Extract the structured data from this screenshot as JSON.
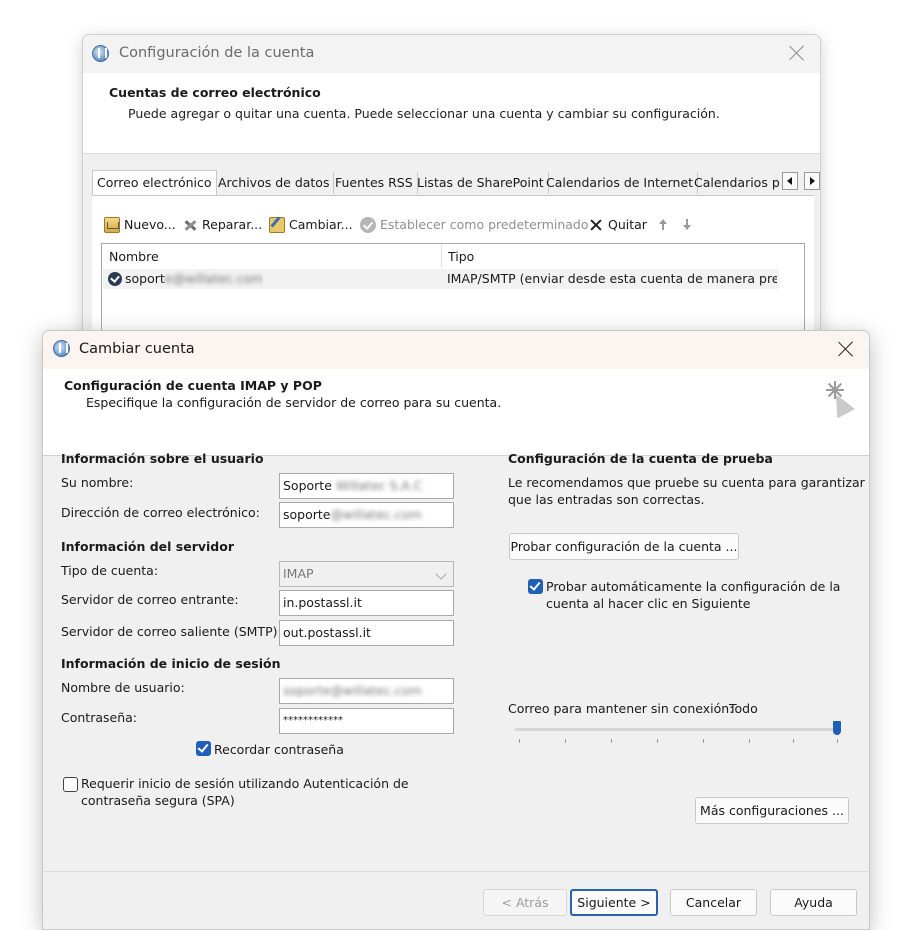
{
  "back_window": {
    "title": "Configuración de la cuenta",
    "header_title": "Cuentas de correo electrónico",
    "header_desc": "Puede agregar o quitar una cuenta. Puede seleccionar una cuenta y cambiar su configuración.",
    "tabs": [
      {
        "label": "Correo electrónico"
      },
      {
        "label": "Archivos de datos"
      },
      {
        "label": "Fuentes RSS"
      },
      {
        "label": "Listas de SharePoint"
      },
      {
        "label": "Calendarios de Internet"
      },
      {
        "label": "Calendarios p"
      }
    ],
    "toolbar": {
      "new": "Nuevo...",
      "repair": "Reparar...",
      "change": "Cambiar...",
      "set_default": "Establecer como predeterminado",
      "remove": "Quitar"
    },
    "columns": {
      "name": "Nombre",
      "type": "Tipo"
    },
    "rows": [
      {
        "name_prefix": "soport",
        "name_hidden": "e@willatec.com",
        "type": "IMAP/SMTP (enviar desde esta cuenta de manera pre..."
      }
    ]
  },
  "front_window": {
    "title": "Cambiar cuenta",
    "header_title": "Configuración de cuenta IMAP y POP",
    "header_desc": "Especifique la configuración de servidor de correo para su cuenta.",
    "user_info": {
      "section": "Información sobre el usuario",
      "name_label": "Su nombre:",
      "name_value_prefix": "Soporte",
      "name_value_hidden": " Willatec S.A.C",
      "email_label": "Dirección de correo electrónico:",
      "email_value_prefix": "soporte",
      "email_value_hidden": "@willatec.com"
    },
    "server_info": {
      "section": "Información del servidor",
      "type_label": "Tipo de cuenta:",
      "type_value": "IMAP",
      "incoming_label": "Servidor de correo entrante:",
      "incoming_value": "in.postassl.it",
      "outgoing_label": "Servidor de correo saliente (SMTP):",
      "outgoing_value": "out.postassl.it"
    },
    "login_info": {
      "section": "Información de inicio de sesión",
      "username_label": "Nombre de usuario:",
      "username_value_hidden": "soporte@willatec.com",
      "password_label": "Contraseña:",
      "password_value": "************",
      "remember_label": "Recordar contraseña",
      "remember_checked": true,
      "spa_label_1": "Requerir inicio de sesión utilizando Autenticación de",
      "spa_label_2": "contraseña segura (SPA)",
      "spa_checked": false
    },
    "test_section": {
      "section": "Configuración de la cuenta de prueba",
      "desc_1": "Le recomendamos que pruebe su cuenta para garantizar",
      "desc_2": "que las entradas son correctas.",
      "test_button": "Probar configuración de la cuenta ...",
      "auto_test_1": "Probar automáticamente la configuración de la",
      "auto_test_2": "cuenta al hacer clic en Siguiente",
      "auto_test_checked": true
    },
    "offline": {
      "label": "Correo para mantener sin conexión:",
      "value": "Todo",
      "slider_position": 1.0
    },
    "more_settings": "Más configuraciones ...",
    "footer": {
      "back": "< Atrás",
      "next": "Siguiente >",
      "cancel": "Cancelar",
      "help": "Ayuda"
    }
  },
  "colors": {
    "accent": "#1f5fb5",
    "window_bg": "#f0f0f0",
    "titlebar_active": "#fbf4f1"
  }
}
